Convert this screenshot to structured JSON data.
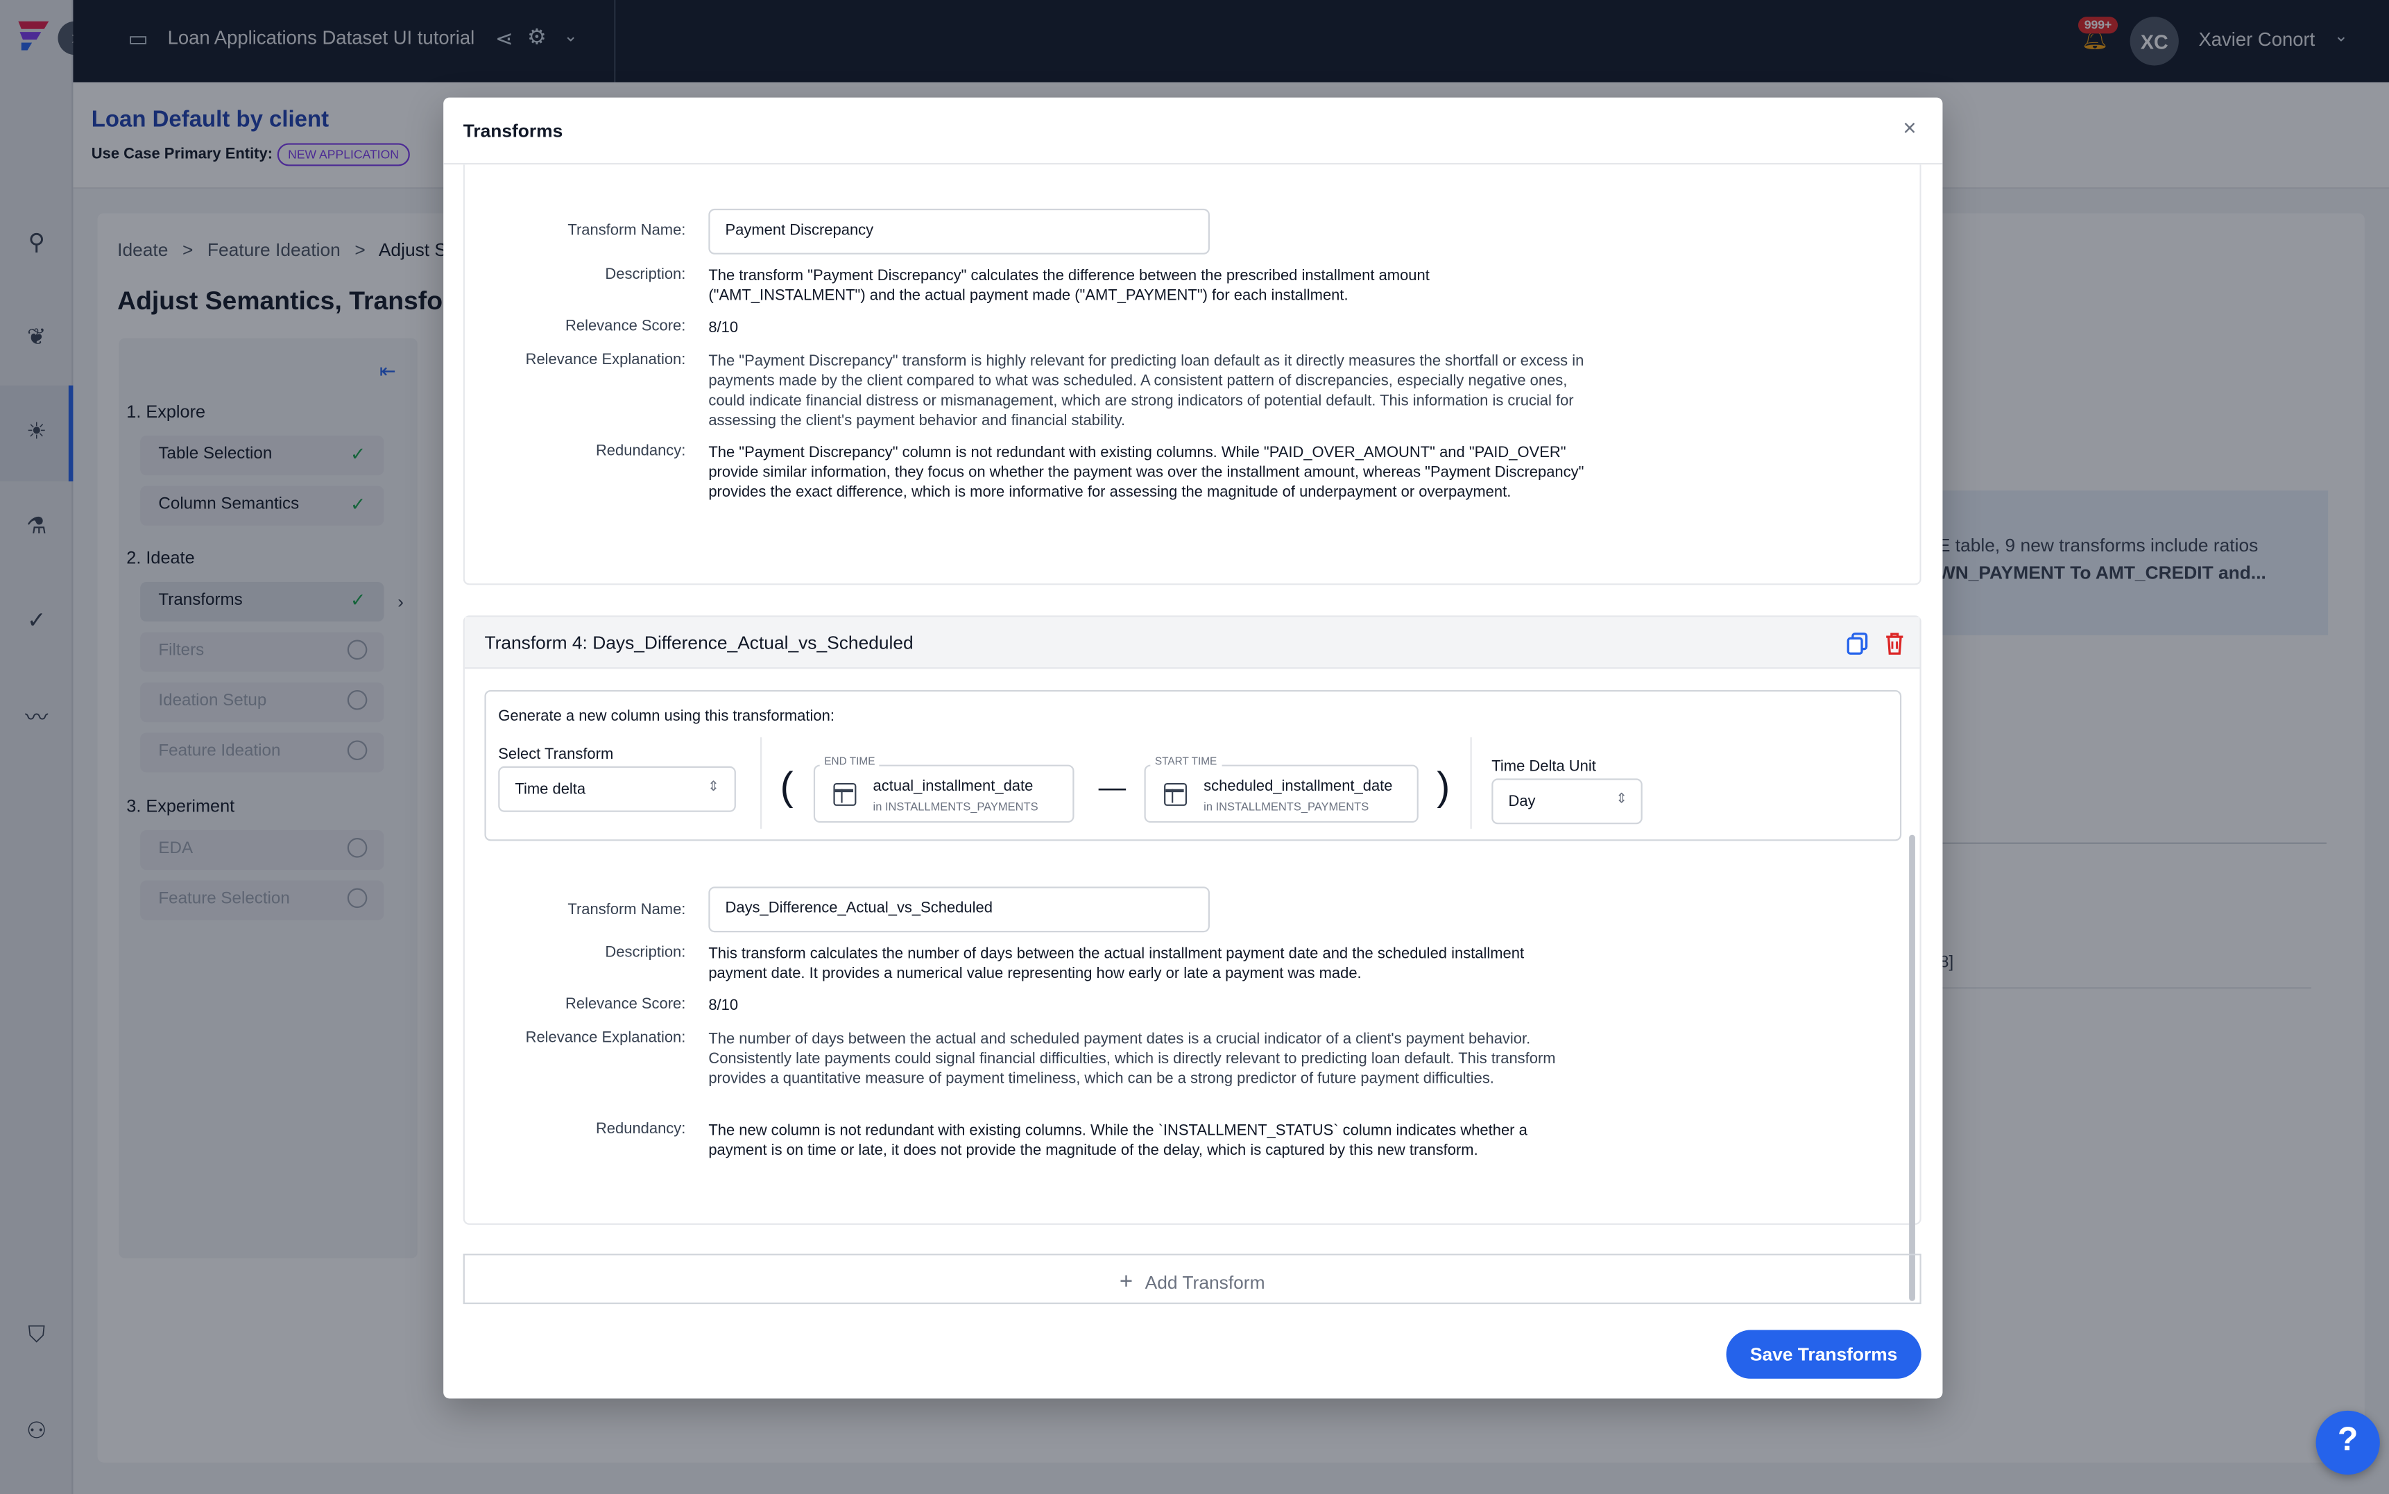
{
  "topbar": {
    "project_title": "Loan Applications Dataset UI tutorial",
    "notification_count": "999+",
    "avatar_initials": "XC",
    "user_name": "Xavier Conort"
  },
  "use_case": {
    "title": "Loan Default by client",
    "entity_label": "Use Case Primary Entity:",
    "entity_badge": "NEW APPLICATION"
  },
  "page": {
    "breadcrumb": [
      "Ideate",
      ">",
      "Feature Ideation",
      ">",
      "Adjust S"
    ],
    "title": "Adjust Semantics, Transfor",
    "right_panel_line1": "E table, 9 new transforms include ratios",
    "right_panel_line2": "WN_PAYMENT To AMT_CREDIT and...",
    "right_bracket_text": "8]"
  },
  "steps": {
    "explore_header": "1. Explore",
    "ideate_header": "2. Ideate",
    "experiment_header": "3. Experiment",
    "items": [
      {
        "label": "Table Selection",
        "state": "done"
      },
      {
        "label": "Column Semantics",
        "state": "done"
      },
      {
        "label": "Transforms",
        "state": "done"
      },
      {
        "label": "Filters",
        "state": "pending"
      },
      {
        "label": "Ideation Setup",
        "state": "pending"
      },
      {
        "label": "Feature Ideation",
        "state": "pending"
      },
      {
        "label": "EDA",
        "state": "pending"
      },
      {
        "label": "Feature Selection",
        "state": "pending"
      }
    ]
  },
  "modal": {
    "title": "Transforms",
    "labels": {
      "transform_name": "Transform Name:",
      "description": "Description:",
      "relevance_score": "Relevance Score:",
      "relevance_explanation": "Relevance Explanation:",
      "redundancy": "Redundancy:"
    },
    "transform3": {
      "name": "Payment Discrepancy",
      "description": "The transform \"Payment Discrepancy\" calculates the difference between the prescribed installment amount (\"AMT_INSTALMENT\") and the actual payment made (\"AMT_PAYMENT\") for each installment.",
      "relevance_score": "8/10",
      "relevance_explanation": "The \"Payment Discrepancy\" transform is highly relevant for predicting loan default as it directly measures the shortfall or excess in payments made by the client compared to what was scheduled. A consistent pattern of discrepancies, especially negative ones, could indicate financial distress or mismanagement, which are strong indicators of potential default. This information is crucial for assessing the client's payment behavior and financial stability.",
      "redundancy": "The \"Payment Discrepancy\" column is not redundant with existing columns. While \"PAID_OVER_AMOUNT\" and \"PAID_OVER\" provide similar information, they focus on whether the payment was over the installment amount, whereas \"Payment Discrepancy\" provides the exact difference, which is more informative for assessing the magnitude of underpayment or overpayment."
    },
    "transform4": {
      "header": "Transform 4: Days_Difference_Actual_vs_Scheduled",
      "generate_label": "Generate a new column using this transformation:",
      "select_transform_label": "Select Transform",
      "select_transform_value": "Time delta",
      "end_time_tag": "END TIME",
      "end_time_column": "actual_installment_date",
      "end_time_table": "in INSTALLMENTS_PAYMENTS",
      "start_time_tag": "START TIME",
      "start_time_column": "scheduled_installment_date",
      "start_time_table": "in INSTALLMENTS_PAYMENTS",
      "time_delta_label": "Time Delta Unit",
      "time_delta_value": "Day",
      "name": "Days_Difference_Actual_vs_Scheduled",
      "description": "This transform calculates the number of days between the actual installment payment date and the scheduled installment payment date. It provides a numerical value representing how early or late a payment was made.",
      "relevance_score": "8/10",
      "relevance_explanation": "The number of days between the actual and scheduled payment dates is a crucial indicator of a client's payment behavior. Consistently late payments could signal financial difficulties, which is directly relevant to predicting loan default. This transform provides a quantitative measure of payment timeliness, which can be a strong predictor of future payment difficulties.",
      "redundancy": "The new column is not redundant with existing columns. While the `INSTALLMENT_STATUS` column indicates whether a payment is on time or late, it does not provide the magnitude of the delay, which is captured by this new transform."
    },
    "add_transform": "Add Transform",
    "save_transforms": "Save Transforms"
  },
  "help_label": "?",
  "colors": {
    "accent": "#2563eb",
    "topbar": "#111827",
    "danger": "#dc2626",
    "success": "#16a34a"
  }
}
